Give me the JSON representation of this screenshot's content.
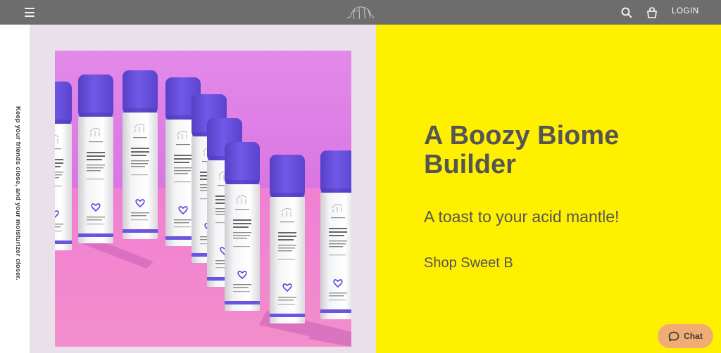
{
  "header": {
    "login_label": "LOGIN",
    "icons": [
      "hamburger-menu-icon",
      "elephant-logo",
      "search-icon",
      "shopping-bag-icon"
    ],
    "bar_color": "#6d6d6d"
  },
  "tagline": "Keep your friends close, and your moisturizer closer.",
  "hero": {
    "title": "A Boozy Biome Builder",
    "subtitle": "A toast to your acid mantle!",
    "cta_label": "Shop Sweet B",
    "background_color": "#fff000",
    "text_color": "#555555"
  },
  "side_panel": {
    "background_color": "#e9e0ea"
  },
  "chat": {
    "label": "Chat",
    "background_color": "#f0ac73"
  },
  "product": {
    "bottle_text": "Sweet Biome Fermented Dew Spray",
    "count": 9
  }
}
